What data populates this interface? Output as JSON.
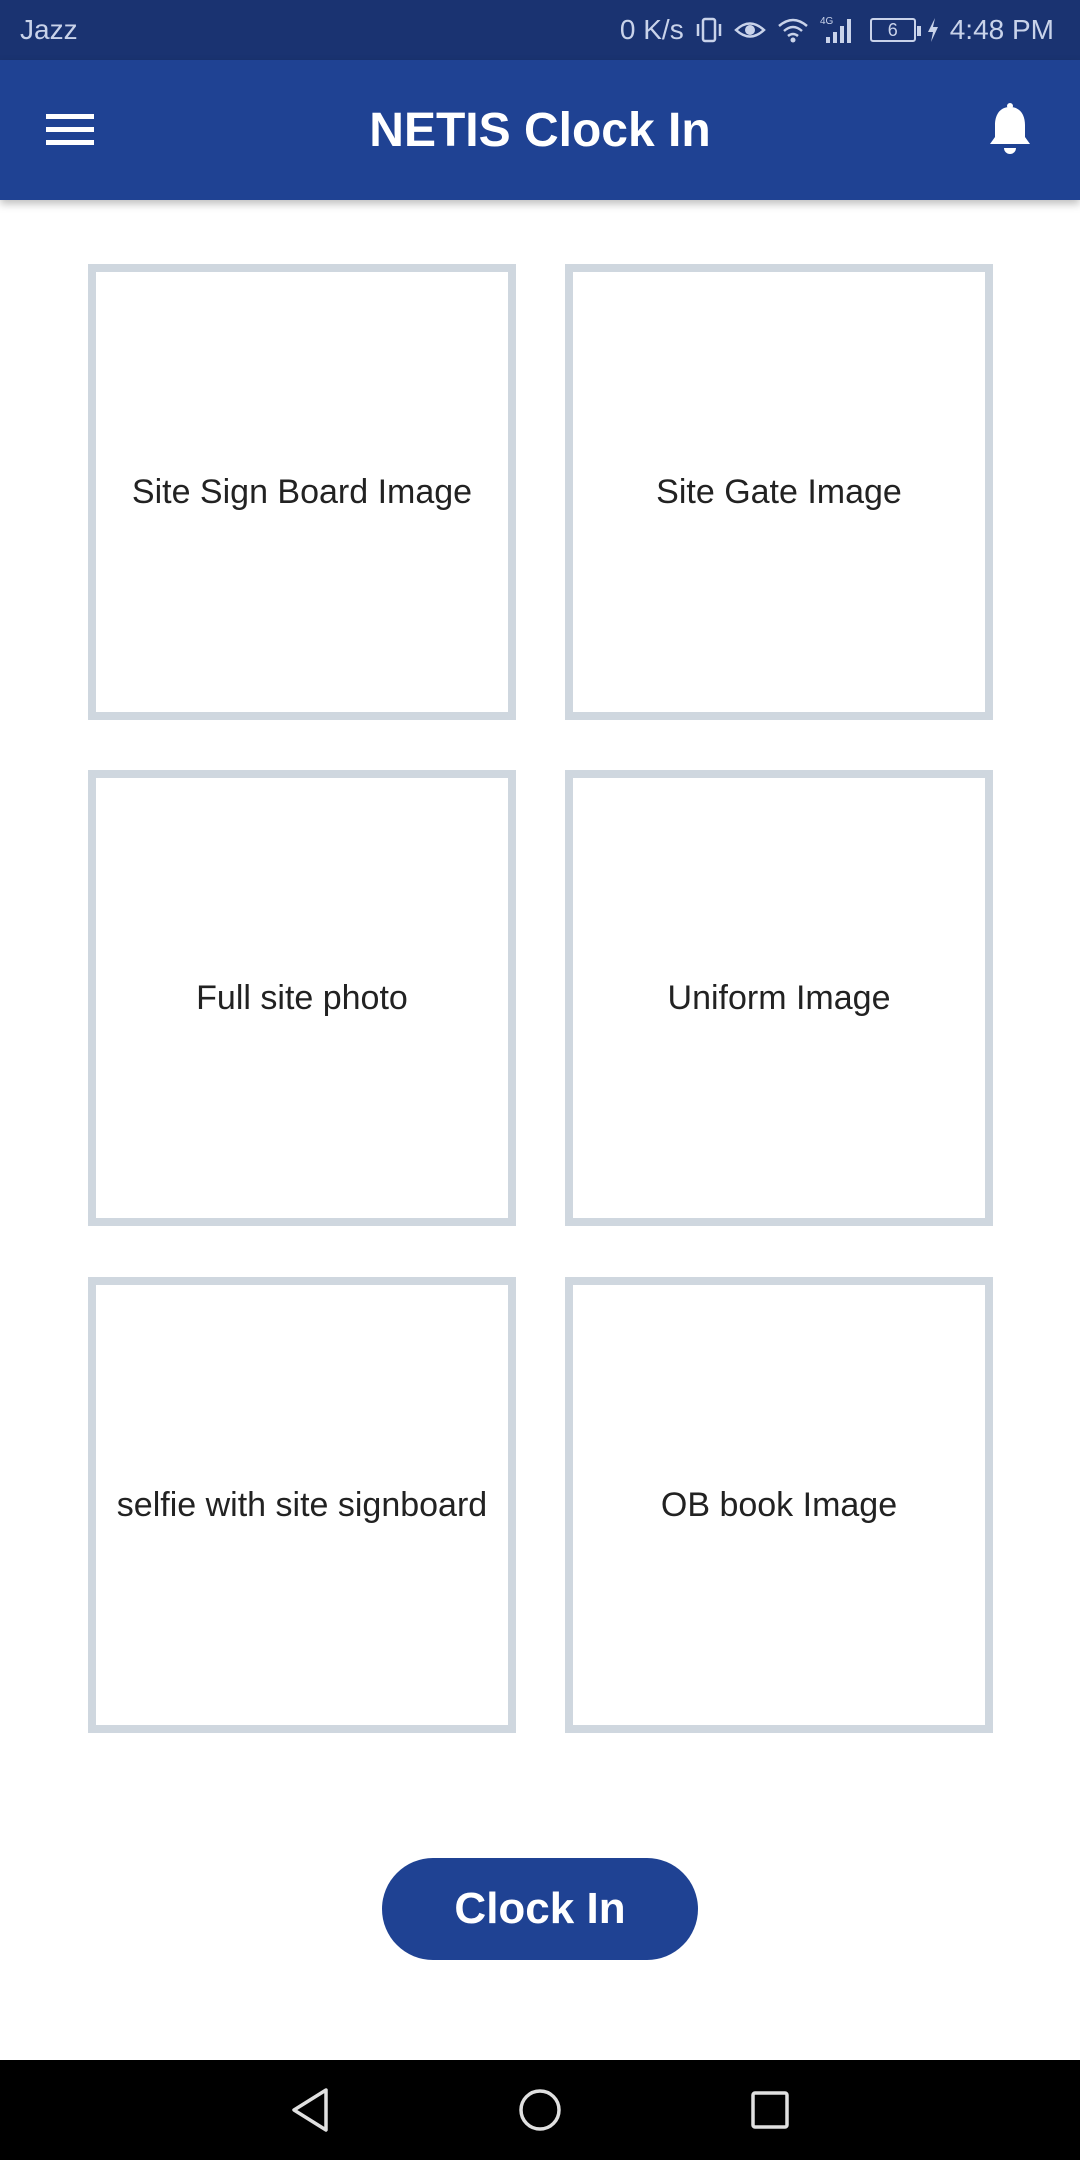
{
  "status_bar": {
    "carrier": "Jazz",
    "network_speed": "0 K/s",
    "network_type": "4G",
    "battery_level": "6",
    "time": "4:48 PM"
  },
  "app_bar": {
    "title": "NETIS Clock In",
    "menu_icon": "hamburger-menu-icon",
    "notification_icon": "bell-icon"
  },
  "image_tiles": [
    {
      "label": "Site Sign Board Image"
    },
    {
      "label": "Site Gate Image"
    },
    {
      "label": "Full site photo"
    },
    {
      "label": "Uniform Image"
    },
    {
      "label": "selfie with site signboard"
    },
    {
      "label": "OB book Image"
    }
  ],
  "actions": {
    "clock_in_label": "Clock In"
  },
  "colors": {
    "primary": "#1f4293",
    "status_bar": "#1a3371",
    "tile_border": "#cfd7df"
  }
}
